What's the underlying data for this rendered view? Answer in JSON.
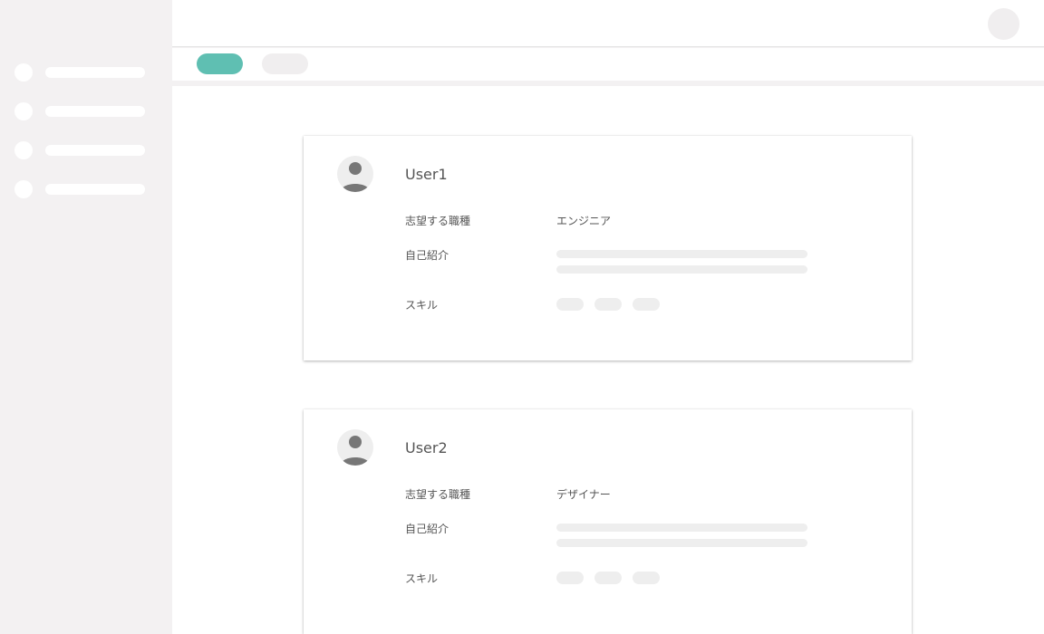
{
  "sidebar": {
    "items": [
      {
        "icon": "placeholder-dot"
      },
      {
        "icon": "placeholder-dot"
      },
      {
        "icon": "placeholder-dot"
      },
      {
        "icon": "placeholder-dot"
      }
    ]
  },
  "header": {
    "avatar_icon": "user-avatar-placeholder"
  },
  "tabs": [
    {
      "state": "active",
      "color": "#5fbfb2"
    },
    {
      "state": "inactive",
      "color": "#f0eeef"
    }
  ],
  "users": [
    {
      "name": "User1",
      "avatar_icon": "person-icon",
      "job_label": "志望する職種",
      "job_value": "エンジニア",
      "intro_label": "自己紹介",
      "skills_label": "スキル"
    },
    {
      "name": "User2",
      "avatar_icon": "person-icon",
      "job_label": "志望する職種",
      "job_value": "デザイナー",
      "intro_label": "自己紹介",
      "skills_label": "スキル"
    }
  ],
  "colors": {
    "accent": "#5fbfb2",
    "sidebar_bg": "#f3f1f2",
    "skeleton": "#eeeeee",
    "text": "#555555"
  }
}
